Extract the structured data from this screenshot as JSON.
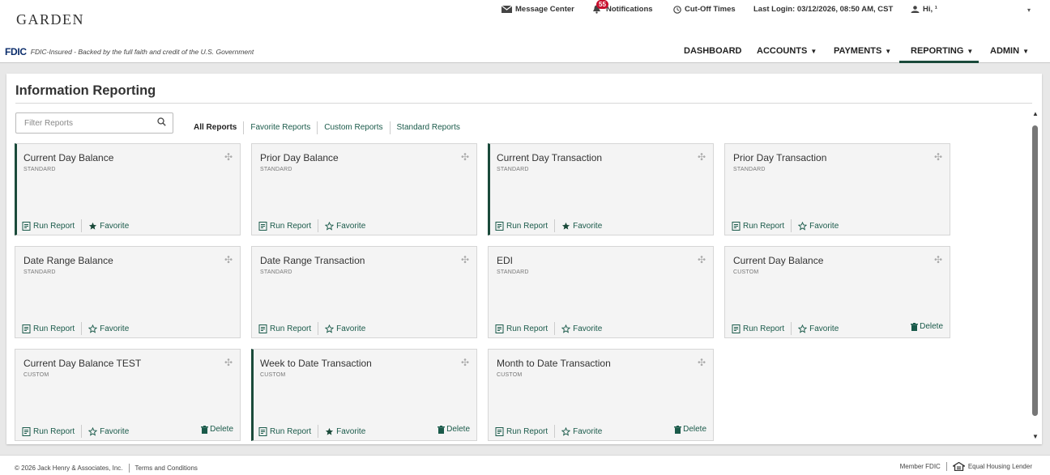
{
  "header": {
    "logo": "GARDEN",
    "message_center": "Message Center",
    "notifications": "Notifications",
    "notification_count": "55",
    "cutoff_times": "Cut-Off Times",
    "last_login": "Last Login: 03/12/2026, 08:50 AM, CST",
    "greeting": "Hi, ¹"
  },
  "fdic": {
    "logo": "FDIC",
    "text": "FDIC-Insured - Backed by the full faith and credit of the U.S. Government"
  },
  "nav": {
    "items": [
      {
        "label": "DASHBOARD",
        "dropdown": false
      },
      {
        "label": "ACCOUNTS",
        "dropdown": true
      },
      {
        "label": "PAYMENTS",
        "dropdown": true
      },
      {
        "label": "REPORTING",
        "dropdown": true,
        "active": true
      },
      {
        "label": "ADMIN",
        "dropdown": true
      }
    ]
  },
  "page": {
    "title": "Information Reporting",
    "filter_placeholder": "Filter Reports",
    "tabs": [
      "All Reports",
      "Favorite Reports",
      "Custom Reports",
      "Standard Reports"
    ],
    "active_tab": "All Reports"
  },
  "actions": {
    "run_report": "Run Report",
    "favorite": "Favorite",
    "delete": "Delete"
  },
  "cards": [
    {
      "title": "Current Day Balance",
      "type": "STANDARD",
      "favorite": true,
      "deletable": false
    },
    {
      "title": "Prior Day Balance",
      "type": "STANDARD",
      "favorite": false,
      "deletable": false
    },
    {
      "title": "Current Day Transaction",
      "type": "STANDARD",
      "favorite": true,
      "deletable": false
    },
    {
      "title": "Prior Day Transaction",
      "type": "STANDARD",
      "favorite": false,
      "deletable": false
    },
    {
      "title": "Date Range Balance",
      "type": "STANDARD",
      "favorite": false,
      "deletable": false
    },
    {
      "title": "Date Range Transaction",
      "type": "STANDARD",
      "favorite": false,
      "deletable": false
    },
    {
      "title": "EDI",
      "type": "STANDARD",
      "favorite": false,
      "deletable": false
    },
    {
      "title": "Current Day Balance",
      "type": "CUSTOM",
      "favorite": false,
      "deletable": true
    },
    {
      "title": "Current Day Balance TEST",
      "type": "CUSTOM",
      "favorite": false,
      "deletable": true
    },
    {
      "title": "Week to Date Transaction",
      "type": "CUSTOM",
      "favorite": true,
      "deletable": true
    },
    {
      "title": "Month to Date Transaction",
      "type": "CUSTOM",
      "favorite": false,
      "deletable": true
    }
  ],
  "footer": {
    "copyright": "© 2026 Jack Henry & Associates, Inc.",
    "terms": "Terms and Conditions",
    "member_fdic": "Member FDIC",
    "equal_housing": "Equal Housing Lender"
  },
  "colors": {
    "accent": "#1a4a3a",
    "link": "#1a5a4a",
    "badge": "#c8102e"
  }
}
